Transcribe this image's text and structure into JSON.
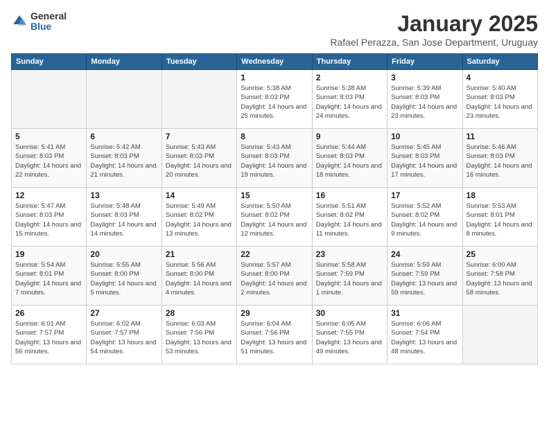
{
  "header": {
    "logo_general": "General",
    "logo_blue": "Blue",
    "month_title": "January 2025",
    "location": "Rafael Perazza, San Jose Department, Uruguay"
  },
  "days_of_week": [
    "Sunday",
    "Monday",
    "Tuesday",
    "Wednesday",
    "Thursday",
    "Friday",
    "Saturday"
  ],
  "weeks": [
    [
      {
        "day": "",
        "info": ""
      },
      {
        "day": "",
        "info": ""
      },
      {
        "day": "",
        "info": ""
      },
      {
        "day": "1",
        "info": "Sunrise: 5:38 AM\nSunset: 8:03 PM\nDaylight: 14 hours and 25 minutes."
      },
      {
        "day": "2",
        "info": "Sunrise: 5:38 AM\nSunset: 8:03 PM\nDaylight: 14 hours and 24 minutes."
      },
      {
        "day": "3",
        "info": "Sunrise: 5:39 AM\nSunset: 8:03 PM\nDaylight: 14 hours and 23 minutes."
      },
      {
        "day": "4",
        "info": "Sunrise: 5:40 AM\nSunset: 8:03 PM\nDaylight: 14 hours and 23 minutes."
      }
    ],
    [
      {
        "day": "5",
        "info": "Sunrise: 5:41 AM\nSunset: 8:03 PM\nDaylight: 14 hours and 22 minutes."
      },
      {
        "day": "6",
        "info": "Sunrise: 5:42 AM\nSunset: 8:03 PM\nDaylight: 14 hours and 21 minutes."
      },
      {
        "day": "7",
        "info": "Sunrise: 5:43 AM\nSunset: 8:03 PM\nDaylight: 14 hours and 20 minutes."
      },
      {
        "day": "8",
        "info": "Sunrise: 5:43 AM\nSunset: 8:03 PM\nDaylight: 14 hours and 19 minutes."
      },
      {
        "day": "9",
        "info": "Sunrise: 5:44 AM\nSunset: 8:03 PM\nDaylight: 14 hours and 18 minutes."
      },
      {
        "day": "10",
        "info": "Sunrise: 5:45 AM\nSunset: 8:03 PM\nDaylight: 14 hours and 17 minutes."
      },
      {
        "day": "11",
        "info": "Sunrise: 5:46 AM\nSunset: 8:03 PM\nDaylight: 14 hours and 16 minutes."
      }
    ],
    [
      {
        "day": "12",
        "info": "Sunrise: 5:47 AM\nSunset: 8:03 PM\nDaylight: 14 hours and 15 minutes."
      },
      {
        "day": "13",
        "info": "Sunrise: 5:48 AM\nSunset: 8:03 PM\nDaylight: 14 hours and 14 minutes."
      },
      {
        "day": "14",
        "info": "Sunrise: 5:49 AM\nSunset: 8:02 PM\nDaylight: 14 hours and 13 minutes."
      },
      {
        "day": "15",
        "info": "Sunrise: 5:50 AM\nSunset: 8:02 PM\nDaylight: 14 hours and 12 minutes."
      },
      {
        "day": "16",
        "info": "Sunrise: 5:51 AM\nSunset: 8:02 PM\nDaylight: 14 hours and 11 minutes."
      },
      {
        "day": "17",
        "info": "Sunrise: 5:52 AM\nSunset: 8:02 PM\nDaylight: 14 hours and 9 minutes."
      },
      {
        "day": "18",
        "info": "Sunrise: 5:53 AM\nSunset: 8:01 PM\nDaylight: 14 hours and 8 minutes."
      }
    ],
    [
      {
        "day": "19",
        "info": "Sunrise: 5:54 AM\nSunset: 8:01 PM\nDaylight: 14 hours and 7 minutes."
      },
      {
        "day": "20",
        "info": "Sunrise: 5:55 AM\nSunset: 8:00 PM\nDaylight: 14 hours and 5 minutes."
      },
      {
        "day": "21",
        "info": "Sunrise: 5:56 AM\nSunset: 8:00 PM\nDaylight: 14 hours and 4 minutes."
      },
      {
        "day": "22",
        "info": "Sunrise: 5:57 AM\nSunset: 8:00 PM\nDaylight: 14 hours and 2 minutes."
      },
      {
        "day": "23",
        "info": "Sunrise: 5:58 AM\nSunset: 7:59 PM\nDaylight: 14 hours and 1 minute."
      },
      {
        "day": "24",
        "info": "Sunrise: 5:59 AM\nSunset: 7:59 PM\nDaylight: 13 hours and 59 minutes."
      },
      {
        "day": "25",
        "info": "Sunrise: 6:00 AM\nSunset: 7:58 PM\nDaylight: 13 hours and 58 minutes."
      }
    ],
    [
      {
        "day": "26",
        "info": "Sunrise: 6:01 AM\nSunset: 7:57 PM\nDaylight: 13 hours and 56 minutes."
      },
      {
        "day": "27",
        "info": "Sunrise: 6:02 AM\nSunset: 7:57 PM\nDaylight: 13 hours and 54 minutes."
      },
      {
        "day": "28",
        "info": "Sunrise: 6:03 AM\nSunset: 7:56 PM\nDaylight: 13 hours and 53 minutes."
      },
      {
        "day": "29",
        "info": "Sunrise: 6:04 AM\nSunset: 7:56 PM\nDaylight: 13 hours and 51 minutes."
      },
      {
        "day": "30",
        "info": "Sunrise: 6:05 AM\nSunset: 7:55 PM\nDaylight: 13 hours and 49 minutes."
      },
      {
        "day": "31",
        "info": "Sunrise: 6:06 AM\nSunset: 7:54 PM\nDaylight: 13 hours and 48 minutes."
      },
      {
        "day": "",
        "info": ""
      }
    ]
  ]
}
